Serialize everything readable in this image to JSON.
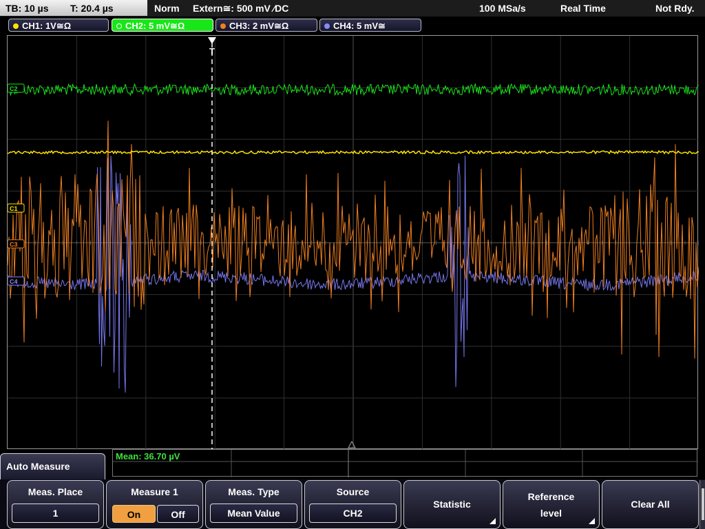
{
  "status": {
    "timebase": "TB: 10 µs",
    "trigger_time": "T: 20.4 µs",
    "mode": "Norm",
    "trigger": "Extern≅: 500 mV ⁄DC",
    "sample_rate": "100 MSa/s",
    "acq_mode": "Real Time",
    "state": "Not Rdy."
  },
  "channels": [
    {
      "label": "CH1: 1V≅Ω",
      "color": "#ffe500",
      "active": false
    },
    {
      "label": "CH2: 5 mV≅Ω",
      "color": "#19e619",
      "active": true
    },
    {
      "label": "CH3: 2 mV≅Ω",
      "color": "#f08020",
      "active": false
    },
    {
      "label": "CH4: 5 mV≅",
      "color": "#8888ff",
      "active": false
    }
  ],
  "markers": {
    "c1": "C1",
    "c2": "C2",
    "c3": "C3",
    "c4": "C4",
    "trigger": "T"
  },
  "measurement": {
    "mean": "Mean: 36.70 µV"
  },
  "menu": {
    "title": "Auto Measure",
    "meas_place": {
      "label": "Meas. Place",
      "value": "1"
    },
    "measure1": {
      "label": "Measure 1",
      "on": "On",
      "off": "Off",
      "selected": "On"
    },
    "meas_type": {
      "label": "Meas. Type",
      "value": "Mean Value"
    },
    "source": {
      "label": "Source",
      "value": "CH2"
    },
    "statistic": {
      "label": "Statistic"
    },
    "reference_level": {
      "label1": "Reference",
      "label2": "level"
    },
    "clear_all": {
      "label": "Clear All"
    }
  }
}
